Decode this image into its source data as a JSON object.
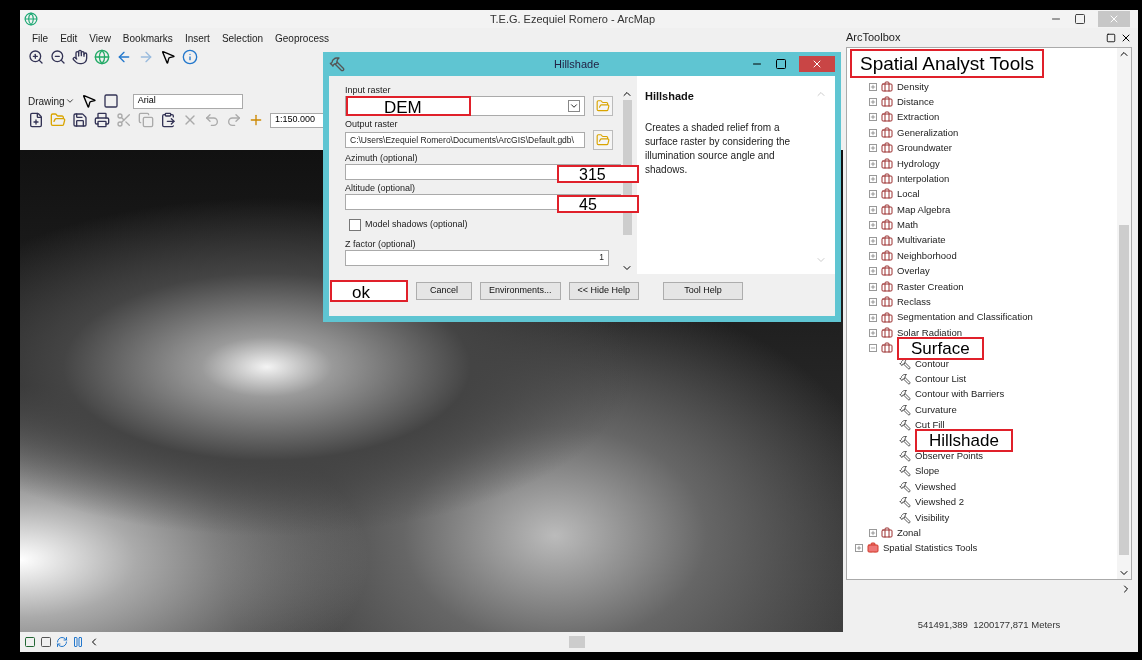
{
  "window": {
    "title": "T.E.G. Ezequiel Romero - ArcMap"
  },
  "menu": [
    "File",
    "Edit",
    "View",
    "Bookmarks",
    "Insert",
    "Selection",
    "Geoprocess"
  ],
  "toolbars": {
    "drawing_label": "Drawing",
    "font": "Arial",
    "scale": "1:150.000"
  },
  "dialog": {
    "title": "Hillshade",
    "fields": [
      {
        "kind": "dropdown",
        "label": "Input raster",
        "annotation": "DEM",
        "browse": true
      },
      {
        "kind": "text",
        "label": "Output raster",
        "value": "C:\\Users\\Ezequiel Romero\\Documents\\ArcGIS\\Default.gdb\\",
        "browse": true
      },
      {
        "kind": "text",
        "label": "Azimuth (optional)",
        "annotation": "315",
        "browse": false
      },
      {
        "kind": "text",
        "label": "Altitude (optional)",
        "annotation": "45",
        "browse": false
      },
      {
        "kind": "checkbox",
        "label": "Model shadows (optional)",
        "checked": false
      },
      {
        "kind": "number",
        "label": "Z factor (optional)",
        "value": "1",
        "browse": false
      }
    ],
    "ok_annotation": "ok",
    "buttons": [
      "Cancel",
      "Environments...",
      "<< Hide Help",
      "Tool Help"
    ],
    "help": {
      "title": "Hillshade",
      "text": "Creates a shaded relief from a surface raster by considering the illumination source angle and shadows."
    }
  },
  "toolbox": {
    "title": "ArcToolbox",
    "annotation": "Spatial Analyst Tools",
    "items": [
      {
        "kind": "toolset",
        "label": "Density",
        "expanded": false,
        "highlighted": false
      },
      {
        "kind": "toolset",
        "label": "Distance",
        "expanded": false,
        "highlighted": false
      },
      {
        "kind": "toolset",
        "label": "Extraction",
        "expanded": false,
        "highlighted": false
      },
      {
        "kind": "toolset",
        "label": "Generalization",
        "expanded": false,
        "highlighted": false
      },
      {
        "kind": "toolset",
        "label": "Groundwater",
        "expanded": false,
        "highlighted": false
      },
      {
        "kind": "toolset",
        "label": "Hydrology",
        "expanded": false,
        "highlighted": false
      },
      {
        "kind": "toolset",
        "label": "Interpolation",
        "expanded": false,
        "highlighted": false
      },
      {
        "kind": "toolset",
        "label": "Local",
        "expanded": false,
        "highlighted": false
      },
      {
        "kind": "toolset",
        "label": "Map Algebra",
        "expanded": false,
        "highlighted": false
      },
      {
        "kind": "toolset",
        "label": "Math",
        "expanded": false,
        "highlighted": false
      },
      {
        "kind": "toolset",
        "label": "Multivariate",
        "expanded": false,
        "highlighted": false
      },
      {
        "kind": "toolset",
        "label": "Neighborhood",
        "expanded": false,
        "highlighted": false
      },
      {
        "kind": "toolset",
        "label": "Overlay",
        "expanded": false,
        "highlighted": false
      },
      {
        "kind": "toolset",
        "label": "Raster Creation",
        "expanded": false,
        "highlighted": false
      },
      {
        "kind": "toolset",
        "label": "Reclass",
        "expanded": false,
        "highlighted": false
      },
      {
        "kind": "toolset",
        "label": "Segmentation and Classification",
        "expanded": false,
        "highlighted": false
      },
      {
        "kind": "toolset",
        "label": "Solar Radiation",
        "expanded": false,
        "highlighted": false
      },
      {
        "kind": "toolset",
        "label": "Surface",
        "expanded": true,
        "highlighted": true,
        "children": [
          {
            "kind": "tool",
            "label": "Contour",
            "highlighted": false
          },
          {
            "kind": "tool",
            "label": "Contour List",
            "highlighted": false
          },
          {
            "kind": "tool",
            "label": "Contour with Barriers",
            "highlighted": false
          },
          {
            "kind": "tool",
            "label": "Curvature",
            "highlighted": false
          },
          {
            "kind": "tool",
            "label": "Cut Fill",
            "highlighted": false
          },
          {
            "kind": "tool",
            "label": "Hillshade",
            "highlighted": true
          },
          {
            "kind": "tool",
            "label": "Observer Points",
            "highlighted": false
          },
          {
            "kind": "tool",
            "label": "Slope",
            "highlighted": false
          },
          {
            "kind": "tool",
            "label": "Viewshed",
            "highlighted": false
          },
          {
            "kind": "tool",
            "label": "Viewshed 2",
            "highlighted": false
          },
          {
            "kind": "tool",
            "label": "Visibility",
            "highlighted": false
          }
        ]
      },
      {
        "kind": "toolset",
        "label": "Zonal",
        "expanded": false,
        "highlighted": false
      },
      {
        "kind": "toolbox",
        "label": "Spatial Statistics Tools",
        "expanded": false,
        "highlighted": false
      }
    ]
  },
  "status_bar": {
    "coordinates": "541491,389  1200177,871 Meters"
  }
}
